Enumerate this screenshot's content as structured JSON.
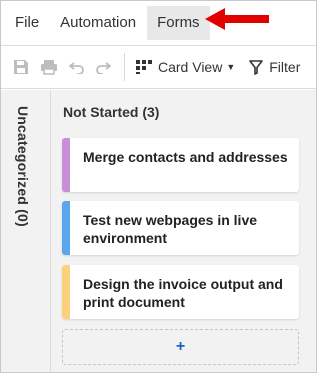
{
  "menu": {
    "items": [
      {
        "label": "File"
      },
      {
        "label": "Automation"
      },
      {
        "label": "Forms"
      }
    ]
  },
  "toolbar": {
    "card_view_label": "Card View",
    "filter_label": "Filter"
  },
  "board": {
    "uncategorized_label": "Uncategorized (0)",
    "column_title": "Not Started (3)",
    "cards": [
      {
        "text": "Merge contacts and addresses",
        "color": "#c78fd6"
      },
      {
        "text": "Test new webpages in live environment",
        "color": "#5aa7ee"
      },
      {
        "text": "Design the invoice output and print document",
        "color": "#fbd17e"
      }
    ],
    "add_label": "+"
  },
  "colors": {
    "annotation_arrow": "#e00000",
    "active_menu_bg": "#e8e8e8",
    "add_button": "#1565c0"
  }
}
